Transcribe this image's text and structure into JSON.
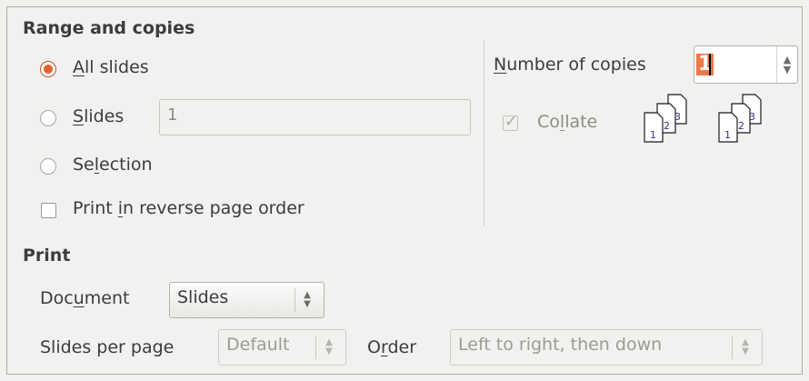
{
  "range": {
    "title": "Range and copies",
    "options": {
      "all_slides": {
        "prefix": "",
        "mnemonic": "A",
        "suffix": "ll slides",
        "checked": true
      },
      "slides": {
        "prefix": "",
        "mnemonic": "S",
        "suffix": "lides",
        "checked": false,
        "value": "1"
      },
      "selection": {
        "prefix": "Se",
        "mnemonic": "l",
        "suffix": "ection",
        "checked": false
      }
    },
    "reverse": {
      "prefix": "Print ",
      "mnemonic": "i",
      "suffix": "n reverse page order",
      "checked": false
    }
  },
  "copies": {
    "label_mnemonic": "N",
    "label_rest": "umber of copies",
    "value": "1",
    "collate": {
      "prefix": "Co",
      "mnemonic": "l",
      "suffix": "late",
      "checked": true,
      "enabled": false
    },
    "icon_page_numbers": [
      "1",
      "2",
      "3"
    ]
  },
  "print": {
    "title": "Print",
    "document": {
      "prefix": "Doc",
      "mnemonic": "u",
      "suffix": "ment",
      "value": "Slides"
    },
    "slides_per_page": {
      "label": "Slides per page",
      "value": "Default"
    },
    "order": {
      "prefix": "O",
      "mnemonic": "r",
      "suffix": "der",
      "value": "Left to right, then down"
    }
  },
  "colors": {
    "accent": "#e4622e",
    "background": "#f2f1f0"
  }
}
